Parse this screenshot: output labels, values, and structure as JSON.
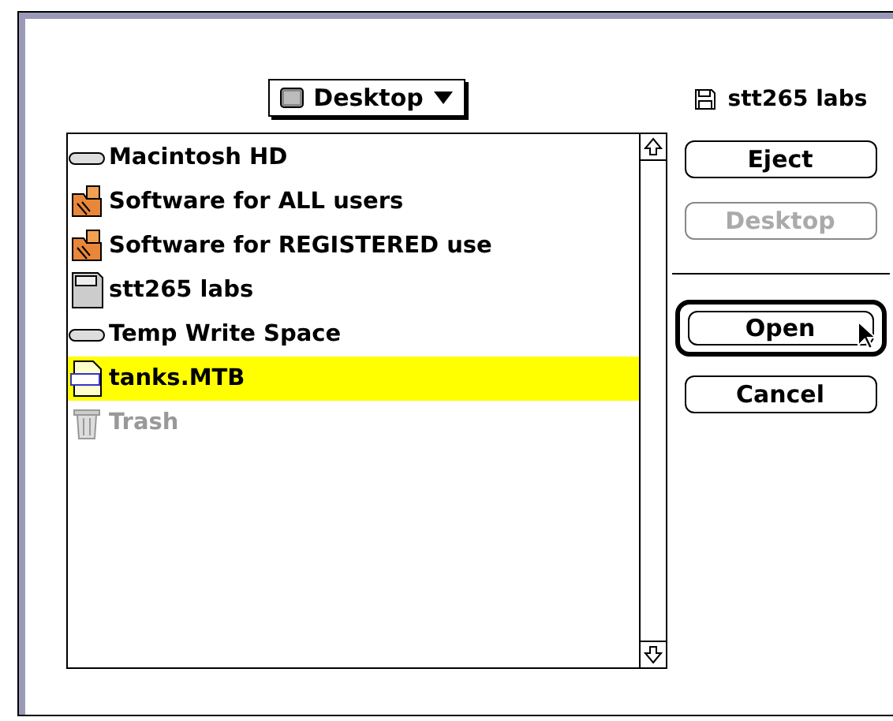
{
  "location_menu": {
    "label": "Desktop"
  },
  "files": [
    {
      "name": "Macintosh HD",
      "kind": "drive",
      "selected": false,
      "disabled": false
    },
    {
      "name": "Software for ALL users",
      "kind": "shared-folder",
      "selected": false,
      "disabled": false
    },
    {
      "name": "Software for REGISTERED use",
      "kind": "shared-folder",
      "selected": false,
      "disabled": false
    },
    {
      "name": "stt265 labs",
      "kind": "floppy",
      "selected": false,
      "disabled": false
    },
    {
      "name": "Temp Write Space",
      "kind": "drive",
      "selected": false,
      "disabled": false
    },
    {
      "name": "tanks.MTB",
      "kind": "document",
      "selected": true,
      "disabled": false
    },
    {
      "name": "Trash",
      "kind": "trash",
      "selected": false,
      "disabled": true
    }
  ],
  "volume": {
    "name": "stt265 labs"
  },
  "buttons": [
    {
      "label": "Eject",
      "disabled": false,
      "default": false
    },
    {
      "label": "Desktop",
      "disabled": true,
      "default": false
    },
    {
      "label": "Open",
      "disabled": false,
      "default": true
    },
    {
      "label": "Cancel",
      "disabled": false,
      "default": false
    }
  ]
}
